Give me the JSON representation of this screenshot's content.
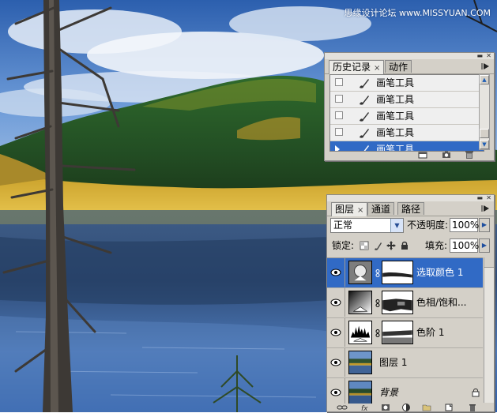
{
  "watermark": "思缘设计论坛 www.MISSYUAN.COM",
  "history_panel": {
    "tabs": [
      {
        "label": "历史记录",
        "close": "×"
      },
      {
        "label": "动作",
        "close": ""
      }
    ],
    "menu_icon": "panel-menu-arrow",
    "items": [
      {
        "label": "画笔工具",
        "selected": false
      },
      {
        "label": "画笔工具",
        "selected": false
      },
      {
        "label": "画笔工具",
        "selected": false
      },
      {
        "label": "画笔工具",
        "selected": false
      },
      {
        "label": "画笔工具",
        "selected": true
      }
    ],
    "footer_icons": [
      "new-document-icon",
      "snapshot-camera-icon",
      "trash-icon"
    ]
  },
  "layers_panel": {
    "tabs": [
      {
        "label": "图层",
        "close": "×"
      },
      {
        "label": "通道",
        "close": ""
      },
      {
        "label": "路径",
        "close": ""
      }
    ],
    "blend_mode": "正常",
    "opacity_label": "不透明度:",
    "opacity_value": "100%",
    "lock_label": "锁定:",
    "fill_label": "填充:",
    "fill_value": "100%",
    "layers": [
      {
        "name": "选取颜色 1",
        "selected": true,
        "italic": false,
        "thumb": "selective-color",
        "has_mask": true,
        "locked": false
      },
      {
        "name": "色相/饱和...",
        "selected": false,
        "italic": false,
        "thumb": "hue-saturation",
        "has_mask": true,
        "locked": false
      },
      {
        "name": "色阶 1",
        "selected": false,
        "italic": false,
        "thumb": "levels",
        "has_mask": true,
        "locked": false
      },
      {
        "name": "图层 1",
        "selected": false,
        "italic": false,
        "thumb": "photo",
        "has_mask": false,
        "locked": false
      },
      {
        "name": "背景",
        "selected": false,
        "italic": true,
        "thumb": "photo",
        "has_mask": false,
        "locked": true
      }
    ],
    "footer_icons": [
      "link-layers-icon",
      "fx-icon",
      "add-mask-icon",
      "adjustment-layer-icon",
      "new-group-icon",
      "new-layer-icon",
      "trash-icon"
    ]
  },
  "colors": {
    "selection": "#316ac5",
    "panel_bg": "#d4d0c8"
  }
}
